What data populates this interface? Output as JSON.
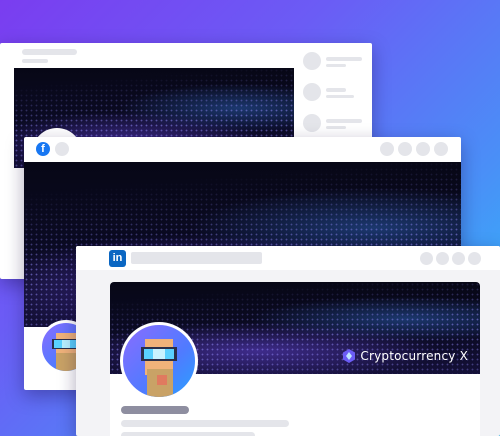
{
  "brand": {
    "name": "Cryptocurrency X"
  },
  "windows": {
    "back": {
      "platform": "generic"
    },
    "middle": {
      "platform": "facebook",
      "logo_text": "f"
    },
    "front": {
      "platform": "linkedin",
      "logo_text": "in"
    }
  },
  "colors": {
    "facebook": "#1877f2",
    "linkedin": "#0a66c2",
    "placeholder": "#e4e5ea"
  },
  "icons": [
    "facebook-logo-icon",
    "linkedin-logo-icon",
    "crypto-brand-icon"
  ]
}
